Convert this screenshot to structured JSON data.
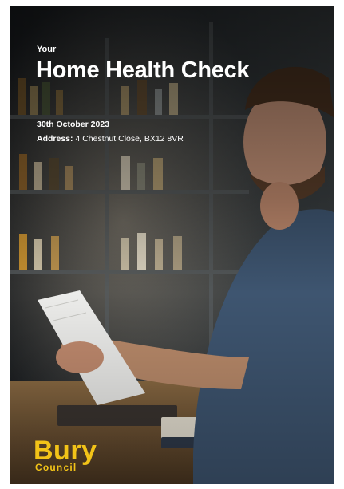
{
  "cover": {
    "eyebrow": "Your",
    "title": "Home Health Check",
    "date": "30th October 2023",
    "address_label": "Address:",
    "address_value": "4 Chestnut Close, BX12 8VR"
  },
  "logo": {
    "line1": "Bury",
    "line2": "Council",
    "color": "#f2c318"
  }
}
